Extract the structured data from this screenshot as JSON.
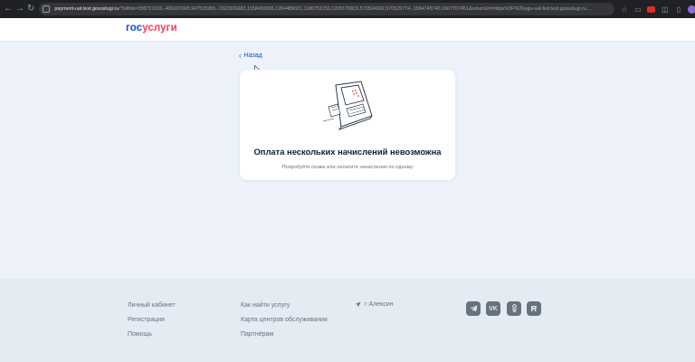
{
  "browser": {
    "url_host": "payment-uat.test.gosuslugi.ru",
    "url_rest": "/?billIds=395721010,-406187665,947525955,-1522926683,1158493365,1264489021,1180751150,1205176819,570524692,570525774,-1584745740,1607707451&returnUrl=https%3F%2Fpgu-uat-fed.test.gosuslugi.ru..."
  },
  "header": {
    "logo_part1": "гос",
    "logo_part2": "услуги"
  },
  "back_link": {
    "label": "Назад"
  },
  "card": {
    "title": "Оплата нескольких начислений невозможна",
    "subtitle": "Попробуйте позже или оплатите начисления по одному"
  },
  "footer": {
    "col1": [
      "Личный кабинет",
      "Регистрация",
      "Помощь"
    ],
    "col2": [
      "Как найти услугу",
      "Карта центров обслуживания",
      "Партнёрам"
    ],
    "location": "г Алексин",
    "social": [
      "telegram-icon",
      "vk-icon",
      "ok-icon",
      "rutube-icon"
    ]
  },
  "colors": {
    "brand_blue": "#0d4cd3",
    "brand_red": "#ee3f58",
    "page_bg": "#edf2fb",
    "footer_bg": "#e4ebf3"
  }
}
